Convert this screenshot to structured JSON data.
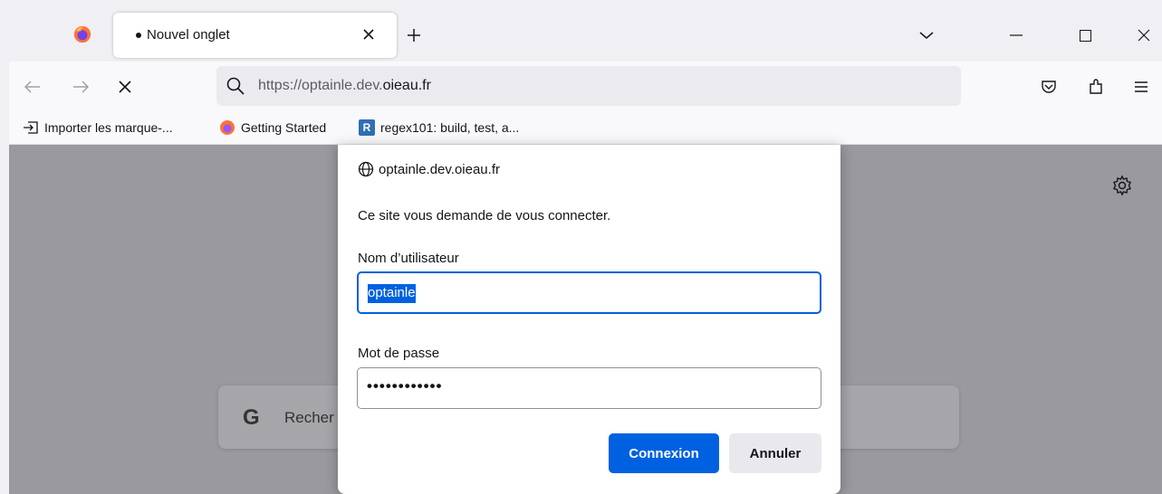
{
  "tab": {
    "title": "Nouvel onglet",
    "close_icon": "close-icon"
  },
  "toolbar": {
    "url_prefix": "https://optainle.dev.",
    "url_domain": "oieau.fr"
  },
  "bookmarks": [
    {
      "label": "Importer les marque-...",
      "icon": "import-icon"
    },
    {
      "label": "Getting Started",
      "icon": "firefox-icon"
    },
    {
      "label": "regex101: build, test, a...",
      "icon": "R"
    }
  ],
  "newtab": {
    "search_placeholder": "Recher"
  },
  "dialog": {
    "origin": "optainle.dev.oieau.fr",
    "message": "Ce site vous demande de vous connecter.",
    "username_label": "Nom d’utilisateur",
    "username_value": "optainle",
    "password_label": "Mot de passe",
    "password_value": "••••••••••••",
    "login_button": "Connexion",
    "cancel_button": "Annuler"
  },
  "colors": {
    "accent": "#0061e0",
    "overlay": "#9a9a9e"
  }
}
